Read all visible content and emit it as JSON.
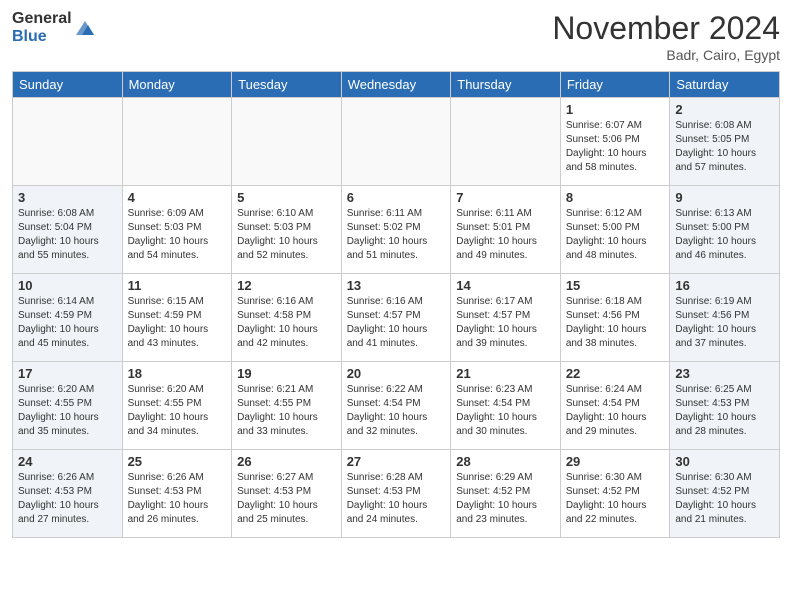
{
  "header": {
    "logo_general": "General",
    "logo_blue": "Blue",
    "month_title": "November 2024",
    "location": "Badr, Cairo, Egypt"
  },
  "weekdays": [
    "Sunday",
    "Monday",
    "Tuesday",
    "Wednesday",
    "Thursday",
    "Friday",
    "Saturday"
  ],
  "weeks": [
    [
      {
        "day": "",
        "info": "",
        "type": "empty"
      },
      {
        "day": "",
        "info": "",
        "type": "empty"
      },
      {
        "day": "",
        "info": "",
        "type": "empty"
      },
      {
        "day": "",
        "info": "",
        "type": "empty"
      },
      {
        "day": "",
        "info": "",
        "type": "empty"
      },
      {
        "day": "1",
        "info": "Sunrise: 6:07 AM\nSunset: 5:06 PM\nDaylight: 10 hours\nand 58 minutes.",
        "type": "weekday"
      },
      {
        "day": "2",
        "info": "Sunrise: 6:08 AM\nSunset: 5:05 PM\nDaylight: 10 hours\nand 57 minutes.",
        "type": "weekend"
      }
    ],
    [
      {
        "day": "3",
        "info": "Sunrise: 6:08 AM\nSunset: 5:04 PM\nDaylight: 10 hours\nand 55 minutes.",
        "type": "weekend"
      },
      {
        "day": "4",
        "info": "Sunrise: 6:09 AM\nSunset: 5:03 PM\nDaylight: 10 hours\nand 54 minutes.",
        "type": "weekday"
      },
      {
        "day": "5",
        "info": "Sunrise: 6:10 AM\nSunset: 5:03 PM\nDaylight: 10 hours\nand 52 minutes.",
        "type": "weekday"
      },
      {
        "day": "6",
        "info": "Sunrise: 6:11 AM\nSunset: 5:02 PM\nDaylight: 10 hours\nand 51 minutes.",
        "type": "weekday"
      },
      {
        "day": "7",
        "info": "Sunrise: 6:11 AM\nSunset: 5:01 PM\nDaylight: 10 hours\nand 49 minutes.",
        "type": "weekday"
      },
      {
        "day": "8",
        "info": "Sunrise: 6:12 AM\nSunset: 5:00 PM\nDaylight: 10 hours\nand 48 minutes.",
        "type": "weekday"
      },
      {
        "day": "9",
        "info": "Sunrise: 6:13 AM\nSunset: 5:00 PM\nDaylight: 10 hours\nand 46 minutes.",
        "type": "weekend"
      }
    ],
    [
      {
        "day": "10",
        "info": "Sunrise: 6:14 AM\nSunset: 4:59 PM\nDaylight: 10 hours\nand 45 minutes.",
        "type": "weekend"
      },
      {
        "day": "11",
        "info": "Sunrise: 6:15 AM\nSunset: 4:59 PM\nDaylight: 10 hours\nand 43 minutes.",
        "type": "weekday"
      },
      {
        "day": "12",
        "info": "Sunrise: 6:16 AM\nSunset: 4:58 PM\nDaylight: 10 hours\nand 42 minutes.",
        "type": "weekday"
      },
      {
        "day": "13",
        "info": "Sunrise: 6:16 AM\nSunset: 4:57 PM\nDaylight: 10 hours\nand 41 minutes.",
        "type": "weekday"
      },
      {
        "day": "14",
        "info": "Sunrise: 6:17 AM\nSunset: 4:57 PM\nDaylight: 10 hours\nand 39 minutes.",
        "type": "weekday"
      },
      {
        "day": "15",
        "info": "Sunrise: 6:18 AM\nSunset: 4:56 PM\nDaylight: 10 hours\nand 38 minutes.",
        "type": "weekday"
      },
      {
        "day": "16",
        "info": "Sunrise: 6:19 AM\nSunset: 4:56 PM\nDaylight: 10 hours\nand 37 minutes.",
        "type": "weekend"
      }
    ],
    [
      {
        "day": "17",
        "info": "Sunrise: 6:20 AM\nSunset: 4:55 PM\nDaylight: 10 hours\nand 35 minutes.",
        "type": "weekend"
      },
      {
        "day": "18",
        "info": "Sunrise: 6:20 AM\nSunset: 4:55 PM\nDaylight: 10 hours\nand 34 minutes.",
        "type": "weekday"
      },
      {
        "day": "19",
        "info": "Sunrise: 6:21 AM\nSunset: 4:55 PM\nDaylight: 10 hours\nand 33 minutes.",
        "type": "weekday"
      },
      {
        "day": "20",
        "info": "Sunrise: 6:22 AM\nSunset: 4:54 PM\nDaylight: 10 hours\nand 32 minutes.",
        "type": "weekday"
      },
      {
        "day": "21",
        "info": "Sunrise: 6:23 AM\nSunset: 4:54 PM\nDaylight: 10 hours\nand 30 minutes.",
        "type": "weekday"
      },
      {
        "day": "22",
        "info": "Sunrise: 6:24 AM\nSunset: 4:54 PM\nDaylight: 10 hours\nand 29 minutes.",
        "type": "weekday"
      },
      {
        "day": "23",
        "info": "Sunrise: 6:25 AM\nSunset: 4:53 PM\nDaylight: 10 hours\nand 28 minutes.",
        "type": "weekend"
      }
    ],
    [
      {
        "day": "24",
        "info": "Sunrise: 6:26 AM\nSunset: 4:53 PM\nDaylight: 10 hours\nand 27 minutes.",
        "type": "weekend"
      },
      {
        "day": "25",
        "info": "Sunrise: 6:26 AM\nSunset: 4:53 PM\nDaylight: 10 hours\nand 26 minutes.",
        "type": "weekday"
      },
      {
        "day": "26",
        "info": "Sunrise: 6:27 AM\nSunset: 4:53 PM\nDaylight: 10 hours\nand 25 minutes.",
        "type": "weekday"
      },
      {
        "day": "27",
        "info": "Sunrise: 6:28 AM\nSunset: 4:53 PM\nDaylight: 10 hours\nand 24 minutes.",
        "type": "weekday"
      },
      {
        "day": "28",
        "info": "Sunrise: 6:29 AM\nSunset: 4:52 PM\nDaylight: 10 hours\nand 23 minutes.",
        "type": "weekday"
      },
      {
        "day": "29",
        "info": "Sunrise: 6:30 AM\nSunset: 4:52 PM\nDaylight: 10 hours\nand 22 minutes.",
        "type": "weekday"
      },
      {
        "day": "30",
        "info": "Sunrise: 6:30 AM\nSunset: 4:52 PM\nDaylight: 10 hours\nand 21 minutes.",
        "type": "weekend"
      }
    ]
  ]
}
